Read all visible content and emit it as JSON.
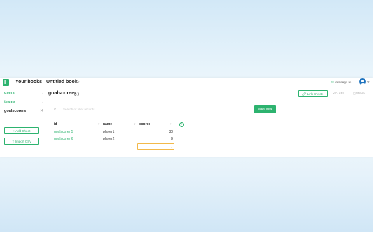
{
  "header": {
    "logo_letter": "F",
    "breadcrumb_books": "Your books",
    "breadcrumb_book": "Untitled book",
    "message_label": "Message us",
    "brand_color": "#2db36f",
    "avatar_color": "#1e73be"
  },
  "sidebar": {
    "sheets": [
      {
        "label": "users",
        "marker": "›"
      },
      {
        "label": "teams",
        "marker": "›"
      },
      {
        "label": "goalscorers",
        "marker": "✕"
      }
    ],
    "add_sheet_label": "Add Sheet",
    "import_csv_label": "Import CSV"
  },
  "main": {
    "sheet_title": "goalscorers",
    "link_sheets_label": "Link Sheets",
    "api_label": "API",
    "share_label": "Share",
    "search_placeholder": "Search or filter records...",
    "save_label": "Save new"
  },
  "table": {
    "columns": [
      {
        "label": "id"
      },
      {
        "label": "name"
      },
      {
        "label": "scores"
      }
    ],
    "rows": [
      {
        "id": "goalscorer 5",
        "name": "player1",
        "scores": "30"
      },
      {
        "id": "goalscorer 6",
        "name": "player2",
        "scores": "9"
      }
    ]
  }
}
